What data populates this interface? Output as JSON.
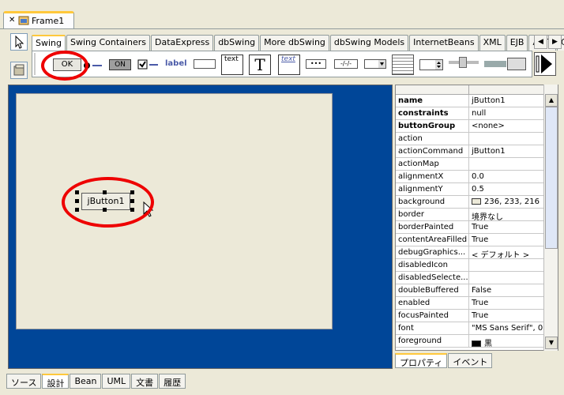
{
  "window": {
    "tab_title": "Frame1"
  },
  "palette_tabs": [
    "Swing",
    "Swing Containers",
    "DataExpress",
    "dbSwing",
    "More dbSwing",
    "dbSwing Models",
    "InternetBeans",
    "XML",
    "EJB",
    "AWT",
    "CC"
  ],
  "palette": {
    "ok_label": "OK",
    "toggle_label": "ON",
    "label_label": "label",
    "text_label": "text",
    "textpane_label": "T",
    "editor_label": "text",
    "password_label": "•••",
    "formatted_label": "-/-/-"
  },
  "form": {
    "button_label": "jButton1"
  },
  "properties": [
    {
      "name": "name",
      "value": "jButton1",
      "bold": true
    },
    {
      "name": "constraints",
      "value": "null",
      "bold": true
    },
    {
      "name": "buttonGroup",
      "value": "<none>",
      "bold": true
    },
    {
      "name": "action",
      "value": ""
    },
    {
      "name": "actionCommand",
      "value": "jButton1"
    },
    {
      "name": "actionMap",
      "value": ""
    },
    {
      "name": "alignmentX",
      "value": "0.0"
    },
    {
      "name": "alignmentY",
      "value": "0.5"
    },
    {
      "name": "background",
      "value": "236, 233, 216",
      "swatch": "#ece9d8"
    },
    {
      "name": "border",
      "value": "境界なし"
    },
    {
      "name": "borderPainted",
      "value": "True"
    },
    {
      "name": "contentAreaFilled",
      "value": "True"
    },
    {
      "name": "debugGraphics...",
      "value": "< デフォルト >"
    },
    {
      "name": "disabledIcon",
      "value": ""
    },
    {
      "name": "disabledSelecte...",
      "value": ""
    },
    {
      "name": "doubleBuffered",
      "value": "False"
    },
    {
      "name": "enabled",
      "value": "True"
    },
    {
      "name": "focusPainted",
      "value": "True"
    },
    {
      "name": "font",
      "value": "\"MS Sans Serif\", 0"
    },
    {
      "name": "foreground",
      "value": "黒",
      "swatch": "#000000"
    }
  ],
  "property_tabs": [
    "プロパティ",
    "イベント"
  ],
  "bottom_tabs": [
    "ソース",
    "設計",
    "Bean",
    "UML",
    "文書",
    "履歴"
  ],
  "active_bottom_tab": "設計",
  "colors": {
    "design_bg": "#004698",
    "highlight": "#e00000",
    "tab_accent": "#ffc83c"
  }
}
